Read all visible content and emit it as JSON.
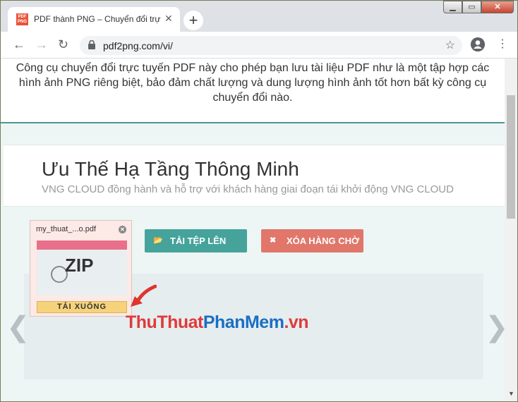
{
  "browser": {
    "tab_title": "PDF thành PNG – Chuyển đổi trự",
    "favicon_text": "PDF PNG",
    "tab_close": "✕",
    "new_tab": "+",
    "url": "pdf2png.com/vi/",
    "window_controls": {
      "minimize": "▁",
      "maximize": "▭",
      "close": "✕"
    }
  },
  "page": {
    "intro_text": "Công cụ chuyển đổi trực tuyến PDF này cho phép bạn lưu tài liệu PDF như là một tập hợp các hình ảnh PNG riêng biệt, bảo đảm chất lượng và dung lượng hình ảnh tốt hơn bất kỳ công cụ chuyển đổi nào.",
    "hero": {
      "title": "Ưu Thế Hạ Tầng Thông Minh",
      "subtitle": "VNG CLOUD đồng hành và hỗ trợ với khách hàng giai đoạn tái khởi động VNG CLOUD"
    },
    "buttons": {
      "upload_label": "TẢI TỆP LÊN",
      "upload_icon": "folder-open-icon",
      "clear_label": "XÓA HÀNG CHỜ",
      "clear_icon": "close-icon"
    },
    "queue": {
      "file_name": "my_thuat_...o.pdf",
      "thumb_label": "ZIP",
      "download_label": "TẢI XUỐNG",
      "remove_icon": "✕"
    },
    "watermark": {
      "part1": "ThuThuat",
      "part2": "PhanMem",
      "part3": ".vn"
    }
  },
  "colors": {
    "upload_button": "#45a39b",
    "clear_button": "#e0776a",
    "download_button": "#f6d37b",
    "card_bg": "#fde9e6",
    "accent_line": "#4a9a93"
  }
}
